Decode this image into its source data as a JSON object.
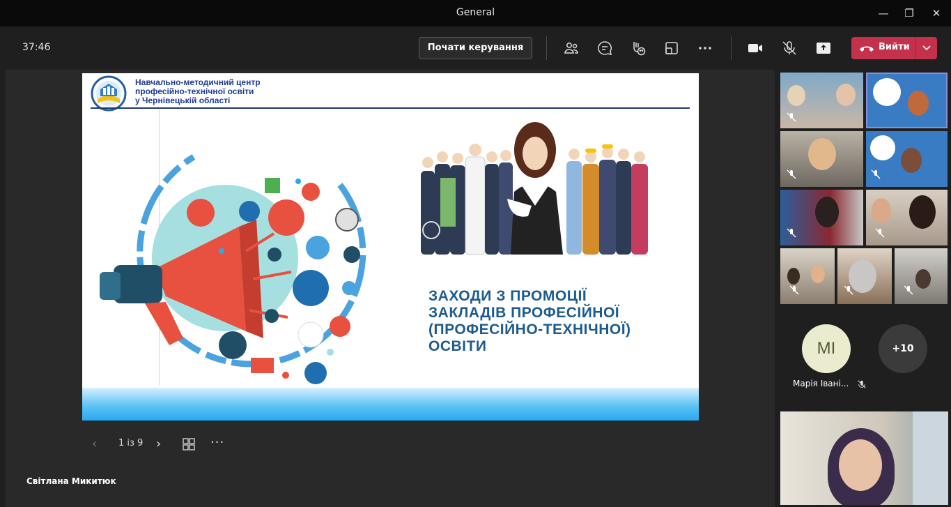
{
  "window": {
    "title": "General",
    "minimize_glyph": "—",
    "maximize_glyph": "❐",
    "close_glyph": "✕"
  },
  "toolbar": {
    "timer": "37:46",
    "take_control_label": "Почати керування",
    "leave_label": "Вийти",
    "icons": [
      "people-icon",
      "chat-icon",
      "reactions-icon",
      "rooms-icon",
      "more-icon",
      "camera-icon",
      "mic-off-icon",
      "share-icon",
      "phone-icon",
      "chevron-down-icon"
    ],
    "leave_color": "#c4314b"
  },
  "slide": {
    "header_lines": [
      "Навчально-методичний центр",
      "професійно-технічної освіти",
      "у Чернівецькій області"
    ],
    "title_lines": [
      "ЗАХОДИ З ПРОМОЦІЇ",
      "ЗАКЛАДІВ ПРОФЕСІЙНОЇ",
      "(ПРОФЕСІЙНО-ТЕХНІЧНОЇ)",
      "ОСВІТИ"
    ],
    "title_color": "#1c5b8f",
    "accent_color": "#e8503f"
  },
  "slide_nav": {
    "prev_glyph": "‹",
    "page_indicator": "1 із 9",
    "next_glyph": "›",
    "more_glyph": "···"
  },
  "presenter_name": "Світлана Микитюк",
  "participants": {
    "avatar_initials": "МІ",
    "avatar_name": "Марія Івані...",
    "overflow_count": "+10"
  }
}
